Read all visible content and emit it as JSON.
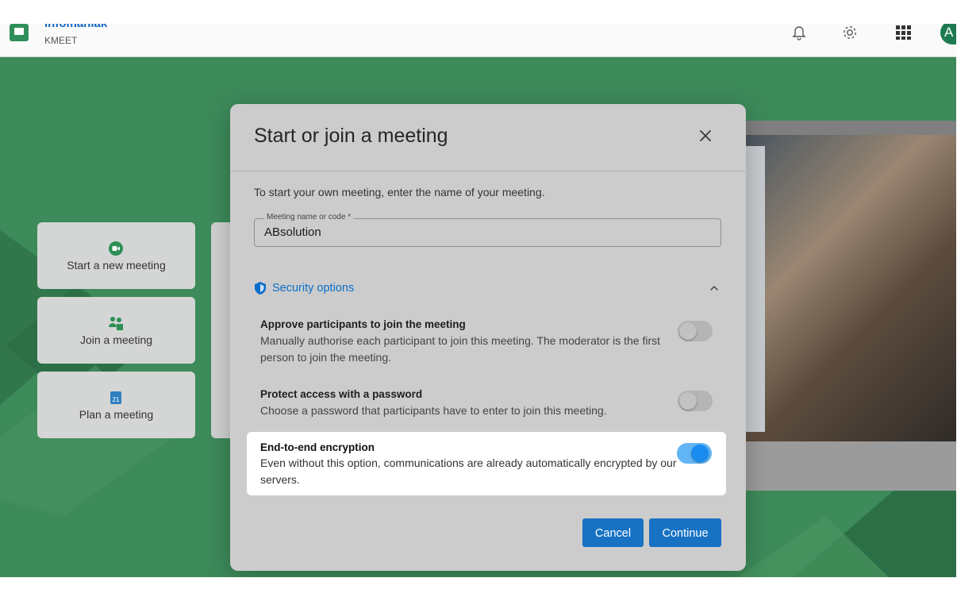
{
  "header": {
    "brand_name": "infomaniak",
    "product_name": "KMEET"
  },
  "background": {
    "cards": [
      {
        "label": "Start a new meeting",
        "icon": "video-icon"
      },
      {
        "label": "Join a meeting",
        "icon": "people-icon"
      },
      {
        "label": "Plan a meeting",
        "icon": "calendar-icon",
        "calendar_day": "21"
      }
    ]
  },
  "dialog": {
    "title": "Start or join a meeting",
    "intro": "To start your own meeting, enter the name of your meeting.",
    "field": {
      "label": "Meeting name or code *",
      "value": "ABsolution"
    },
    "security": {
      "label": "Security options",
      "expanded": true
    },
    "options": [
      {
        "title": "Approve participants to join the meeting",
        "description": "Manually authorise each participant to join this meeting. The moderator is the first person to join the meeting.",
        "enabled": false
      },
      {
        "title": "Protect access with a password",
        "description": "Choose a password that participants have to enter to join this meeting.",
        "enabled": false
      },
      {
        "title": "End-to-end encryption",
        "description": "Even without this option, communications are already automatically encrypted by our servers.",
        "enabled": true
      }
    ],
    "buttons": {
      "cancel": "Cancel",
      "continue": "Continue"
    }
  },
  "colors": {
    "accent": "#1772c4",
    "toggle_on": "#1a8cf0",
    "link": "#0a6ec8",
    "background_green": "#3f8a5c"
  }
}
